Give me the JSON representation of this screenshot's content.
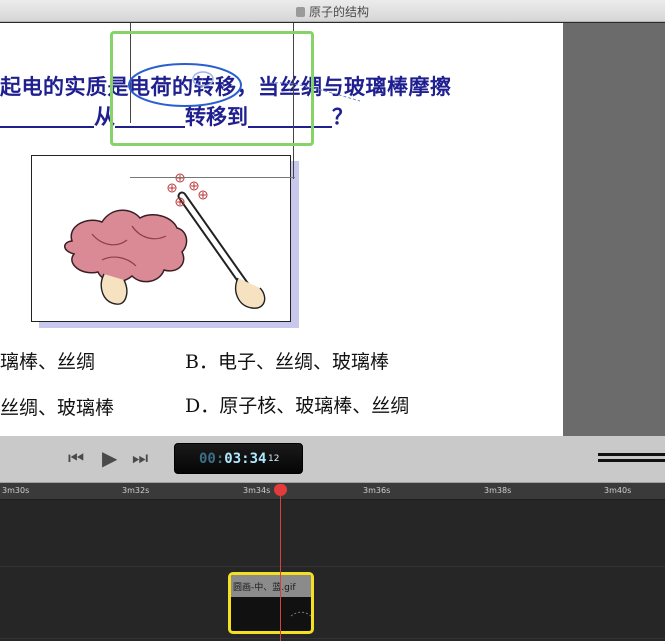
{
  "window": {
    "title": "原子的结构"
  },
  "slide": {
    "question_line1": "起电的实质是电荷的转移，当丝绸与玻璃棒摩擦",
    "question_from": "从",
    "question_to": "转移到",
    "question_mark": "？",
    "option_a_partial": "璃棒、丝绸",
    "option_b": "B．电子、丝绸、玻璃棒",
    "option_c_partial": "丝绸、玻璃棒",
    "option_d": "D．原子核、玻璃棒、丝绸"
  },
  "transport": {
    "timecode_dim": "00:",
    "timecode_main": "03:34",
    "timecode_frames": "12"
  },
  "timeline": {
    "ruler_labels": [
      "3m30s",
      "3m32s",
      "3m34s",
      "3m36s",
      "3m38s",
      "3m40s"
    ],
    "clip_name": "圆画-中、蓝.gif"
  },
  "colors": {
    "question_text": "#1f1f8f",
    "selection_outline": "#86d36a",
    "clip_outline": "#f4e022",
    "playhead": "#e23b3b"
  },
  "icons": [
    "document-icon",
    "rewind-icon",
    "play-icon",
    "fast-forward-icon",
    "playhead-icon"
  ]
}
